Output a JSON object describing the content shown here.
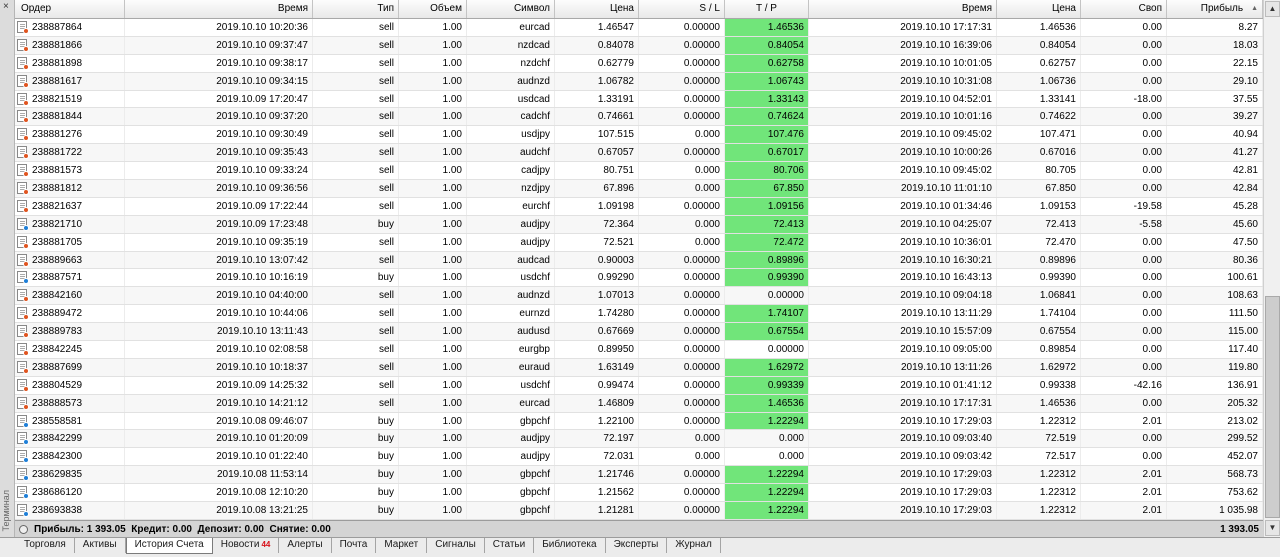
{
  "window": {
    "side_label": "Терминал",
    "close_glyph": "×"
  },
  "columns": {
    "order": "Ордер",
    "open_time": "Время",
    "type": "Тип",
    "volume": "Объем",
    "symbol": "Символ",
    "open_price": "Цена",
    "sl": "S / L",
    "tp": "T / P",
    "close_time": "Время",
    "close_price": "Цена",
    "swap": "Своп",
    "profit": "Прибыль",
    "sort_indicator": "▲"
  },
  "rows": [
    {
      "order": "238887864",
      "open_time": "2019.10.10 10:20:36",
      "type": "sell",
      "volume": "1.00",
      "symbol": "eurcad",
      "open_price": "1.46547",
      "sl": "0.00000",
      "tp": "1.46536",
      "tp_hit": true,
      "close_time": "2019.10.10 17:17:31",
      "close_price": "1.46536",
      "swap": "0.00",
      "profit": "8.27"
    },
    {
      "order": "238881866",
      "open_time": "2019.10.10 09:37:47",
      "type": "sell",
      "volume": "1.00",
      "symbol": "nzdcad",
      "open_price": "0.84078",
      "sl": "0.00000",
      "tp": "0.84054",
      "tp_hit": true,
      "close_time": "2019.10.10 16:39:06",
      "close_price": "0.84054",
      "swap": "0.00",
      "profit": "18.03"
    },
    {
      "order": "238881898",
      "open_time": "2019.10.10 09:38:17",
      "type": "sell",
      "volume": "1.00",
      "symbol": "nzdchf",
      "open_price": "0.62779",
      "sl": "0.00000",
      "tp": "0.62758",
      "tp_hit": true,
      "close_time": "2019.10.10 10:01:05",
      "close_price": "0.62757",
      "swap": "0.00",
      "profit": "22.15"
    },
    {
      "order": "238881617",
      "open_time": "2019.10.10 09:34:15",
      "type": "sell",
      "volume": "1.00",
      "symbol": "audnzd",
      "open_price": "1.06782",
      "sl": "0.00000",
      "tp": "1.06743",
      "tp_hit": true,
      "close_time": "2019.10.10 10:31:08",
      "close_price": "1.06736",
      "swap": "0.00",
      "profit": "29.10"
    },
    {
      "order": "238821519",
      "open_time": "2019.10.09 17:20:47",
      "type": "sell",
      "volume": "1.00",
      "symbol": "usdcad",
      "open_price": "1.33191",
      "sl": "0.00000",
      "tp": "1.33143",
      "tp_hit": true,
      "close_time": "2019.10.10 04:52:01",
      "close_price": "1.33141",
      "swap": "-18.00",
      "profit": "37.55"
    },
    {
      "order": "238881844",
      "open_time": "2019.10.10 09:37:20",
      "type": "sell",
      "volume": "1.00",
      "symbol": "cadchf",
      "open_price": "0.74661",
      "sl": "0.00000",
      "tp": "0.74624",
      "tp_hit": true,
      "close_time": "2019.10.10 10:01:16",
      "close_price": "0.74622",
      "swap": "0.00",
      "profit": "39.27"
    },
    {
      "order": "238881276",
      "open_time": "2019.10.10 09:30:49",
      "type": "sell",
      "volume": "1.00",
      "symbol": "usdjpy",
      "open_price": "107.515",
      "sl": "0.000",
      "tp": "107.476",
      "tp_hit": true,
      "close_time": "2019.10.10 09:45:02",
      "close_price": "107.471",
      "swap": "0.00",
      "profit": "40.94"
    },
    {
      "order": "238881722",
      "open_time": "2019.10.10 09:35:43",
      "type": "sell",
      "volume": "1.00",
      "symbol": "audchf",
      "open_price": "0.67057",
      "sl": "0.00000",
      "tp": "0.67017",
      "tp_hit": true,
      "close_time": "2019.10.10 10:00:26",
      "close_price": "0.67016",
      "swap": "0.00",
      "profit": "41.27"
    },
    {
      "order": "238881573",
      "open_time": "2019.10.10 09:33:24",
      "type": "sell",
      "volume": "1.00",
      "symbol": "cadjpy",
      "open_price": "80.751",
      "sl": "0.000",
      "tp": "80.706",
      "tp_hit": true,
      "close_time": "2019.10.10 09:45:02",
      "close_price": "80.705",
      "swap": "0.00",
      "profit": "42.81"
    },
    {
      "order": "238881812",
      "open_time": "2019.10.10 09:36:56",
      "type": "sell",
      "volume": "1.00",
      "symbol": "nzdjpy",
      "open_price": "67.896",
      "sl": "0.000",
      "tp": "67.850",
      "tp_hit": true,
      "close_time": "2019.10.10 11:01:10",
      "close_price": "67.850",
      "swap": "0.00",
      "profit": "42.84"
    },
    {
      "order": "238821637",
      "open_time": "2019.10.09 17:22:44",
      "type": "sell",
      "volume": "1.00",
      "symbol": "eurchf",
      "open_price": "1.09198",
      "sl": "0.00000",
      "tp": "1.09156",
      "tp_hit": true,
      "close_time": "2019.10.10 01:34:46",
      "close_price": "1.09153",
      "swap": "-19.58",
      "profit": "45.28"
    },
    {
      "order": "238821710",
      "open_time": "2019.10.09 17:23:48",
      "type": "buy",
      "volume": "1.00",
      "symbol": "audjpy",
      "open_price": "72.364",
      "sl": "0.000",
      "tp": "72.413",
      "tp_hit": true,
      "close_time": "2019.10.10 04:25:07",
      "close_price": "72.413",
      "swap": "-5.58",
      "profit": "45.60"
    },
    {
      "order": "238881705",
      "open_time": "2019.10.10 09:35:19",
      "type": "sell",
      "volume": "1.00",
      "symbol": "audjpy",
      "open_price": "72.521",
      "sl": "0.000",
      "tp": "72.472",
      "tp_hit": true,
      "close_time": "2019.10.10 10:36:01",
      "close_price": "72.470",
      "swap": "0.00",
      "profit": "47.50"
    },
    {
      "order": "238889663",
      "open_time": "2019.10.10 13:07:42",
      "type": "sell",
      "volume": "1.00",
      "symbol": "audcad",
      "open_price": "0.90003",
      "sl": "0.00000",
      "tp": "0.89896",
      "tp_hit": true,
      "close_time": "2019.10.10 16:30:21",
      "close_price": "0.89896",
      "swap": "0.00",
      "profit": "80.36"
    },
    {
      "order": "238887571",
      "open_time": "2019.10.10 10:16:19",
      "type": "buy",
      "volume": "1.00",
      "symbol": "usdchf",
      "open_price": "0.99290",
      "sl": "0.00000",
      "tp": "0.99390",
      "tp_hit": true,
      "close_time": "2019.10.10 16:43:13",
      "close_price": "0.99390",
      "swap": "0.00",
      "profit": "100.61"
    },
    {
      "order": "238842160",
      "open_time": "2019.10.10 04:40:00",
      "type": "sell",
      "volume": "1.00",
      "symbol": "audnzd",
      "open_price": "1.07013",
      "sl": "0.00000",
      "tp": "0.00000",
      "tp_hit": false,
      "close_time": "2019.10.10 09:04:18",
      "close_price": "1.06841",
      "swap": "0.00",
      "profit": "108.63"
    },
    {
      "order": "238889472",
      "open_time": "2019.10.10 10:44:06",
      "type": "sell",
      "volume": "1.00",
      "symbol": "eurnzd",
      "open_price": "1.74280",
      "sl": "0.00000",
      "tp": "1.74107",
      "tp_hit": true,
      "close_time": "2019.10.10 13:11:29",
      "close_price": "1.74104",
      "swap": "0.00",
      "profit": "111.50"
    },
    {
      "order": "238889783",
      "open_time": "2019.10.10 13:11:43",
      "type": "sell",
      "volume": "1.00",
      "symbol": "audusd",
      "open_price": "0.67669",
      "sl": "0.00000",
      "tp": "0.67554",
      "tp_hit": true,
      "close_time": "2019.10.10 15:57:09",
      "close_price": "0.67554",
      "swap": "0.00",
      "profit": "115.00"
    },
    {
      "order": "238842245",
      "open_time": "2019.10.10 02:08:58",
      "type": "sell",
      "volume": "1.00",
      "symbol": "eurgbp",
      "open_price": "0.89950",
      "sl": "0.00000",
      "tp": "0.00000",
      "tp_hit": false,
      "close_time": "2019.10.10 09:05:00",
      "close_price": "0.89854",
      "swap": "0.00",
      "profit": "117.40"
    },
    {
      "order": "238887699",
      "open_time": "2019.10.10 10:18:37",
      "type": "sell",
      "volume": "1.00",
      "symbol": "euraud",
      "open_price": "1.63149",
      "sl": "0.00000",
      "tp": "1.62972",
      "tp_hit": true,
      "close_time": "2019.10.10 13:11:26",
      "close_price": "1.62972",
      "swap": "0.00",
      "profit": "119.80"
    },
    {
      "order": "238804529",
      "open_time": "2019.10.09 14:25:32",
      "type": "sell",
      "volume": "1.00",
      "symbol": "usdchf",
      "open_price": "0.99474",
      "sl": "0.00000",
      "tp": "0.99339",
      "tp_hit": true,
      "close_time": "2019.10.10 01:41:12",
      "close_price": "0.99338",
      "swap": "-42.16",
      "profit": "136.91"
    },
    {
      "order": "238888573",
      "open_time": "2019.10.10 14:21:12",
      "type": "sell",
      "volume": "1.00",
      "symbol": "eurcad",
      "open_price": "1.46809",
      "sl": "0.00000",
      "tp": "1.46536",
      "tp_hit": true,
      "close_time": "2019.10.10 17:17:31",
      "close_price": "1.46536",
      "swap": "0.00",
      "profit": "205.32"
    },
    {
      "order": "238558581",
      "open_time": "2019.10.08 09:46:07",
      "type": "buy",
      "volume": "1.00",
      "symbol": "gbpchf",
      "open_price": "1.22100",
      "sl": "0.00000",
      "tp": "1.22294",
      "tp_hit": true,
      "close_time": "2019.10.10 17:29:03",
      "close_price": "1.22312",
      "swap": "2.01",
      "profit": "213.02"
    },
    {
      "order": "238842299",
      "open_time": "2019.10.10 01:20:09",
      "type": "buy",
      "volume": "1.00",
      "symbol": "audjpy",
      "open_price": "72.197",
      "sl": "0.000",
      "tp": "0.000",
      "tp_hit": false,
      "close_time": "2019.10.10 09:03:40",
      "close_price": "72.519",
      "swap": "0.00",
      "profit": "299.52"
    },
    {
      "order": "238842300",
      "open_time": "2019.10.10 01:22:40",
      "type": "buy",
      "volume": "1.00",
      "symbol": "audjpy",
      "open_price": "72.031",
      "sl": "0.000",
      "tp": "0.000",
      "tp_hit": false,
      "close_time": "2019.10.10 09:03:42",
      "close_price": "72.517",
      "swap": "0.00",
      "profit": "452.07"
    },
    {
      "order": "238629835",
      "open_time": "2019.10.08 11:53:14",
      "type": "buy",
      "volume": "1.00",
      "symbol": "gbpchf",
      "open_price": "1.21746",
      "sl": "0.00000",
      "tp": "1.22294",
      "tp_hit": true,
      "close_time": "2019.10.10 17:29:03",
      "close_price": "1.22312",
      "swap": "2.01",
      "profit": "568.73"
    },
    {
      "order": "238686120",
      "open_time": "2019.10.08 12:10:20",
      "type": "buy",
      "volume": "1.00",
      "symbol": "gbpchf",
      "open_price": "1.21562",
      "sl": "0.00000",
      "tp": "1.22294",
      "tp_hit": true,
      "close_time": "2019.10.10 17:29:03",
      "close_price": "1.22312",
      "swap": "2.01",
      "profit": "753.62"
    },
    {
      "order": "238693838",
      "open_time": "2019.10.08 13:21:25",
      "type": "buy",
      "volume": "1.00",
      "symbol": "gbpchf",
      "open_price": "1.21281",
      "sl": "0.00000",
      "tp": "1.22294",
      "tp_hit": true,
      "close_time": "2019.10.10 17:29:03",
      "close_price": "1.22312",
      "swap": "2.01",
      "profit": "1 035.98"
    }
  ],
  "summary": {
    "text": "Прибыль: 1 393.05  Кредит: 0.00  Депозит: 0.00  Снятие: 0.00",
    "total": "1 393.05"
  },
  "tabs": [
    {
      "label": "Торговля",
      "active": false,
      "badge": ""
    },
    {
      "label": "Активы",
      "active": false,
      "badge": ""
    },
    {
      "label": "История Счета",
      "active": true,
      "badge": ""
    },
    {
      "label": "Новости",
      "active": false,
      "badge": "44"
    },
    {
      "label": "Алерты",
      "active": false,
      "badge": ""
    },
    {
      "label": "Почта",
      "active": false,
      "badge": ""
    },
    {
      "label": "Маркет",
      "active": false,
      "badge": ""
    },
    {
      "label": "Сигналы",
      "active": false,
      "badge": ""
    },
    {
      "label": "Статьи",
      "active": false,
      "badge": ""
    },
    {
      "label": "Библиотека",
      "active": false,
      "badge": ""
    },
    {
      "label": "Эксперты",
      "active": false,
      "badge": ""
    },
    {
      "label": "Журнал",
      "active": false,
      "badge": ""
    }
  ],
  "colors": {
    "tp_hit": "#71e57a",
    "sell_dot": "#e0541f",
    "buy_dot": "#1e7fd8"
  }
}
